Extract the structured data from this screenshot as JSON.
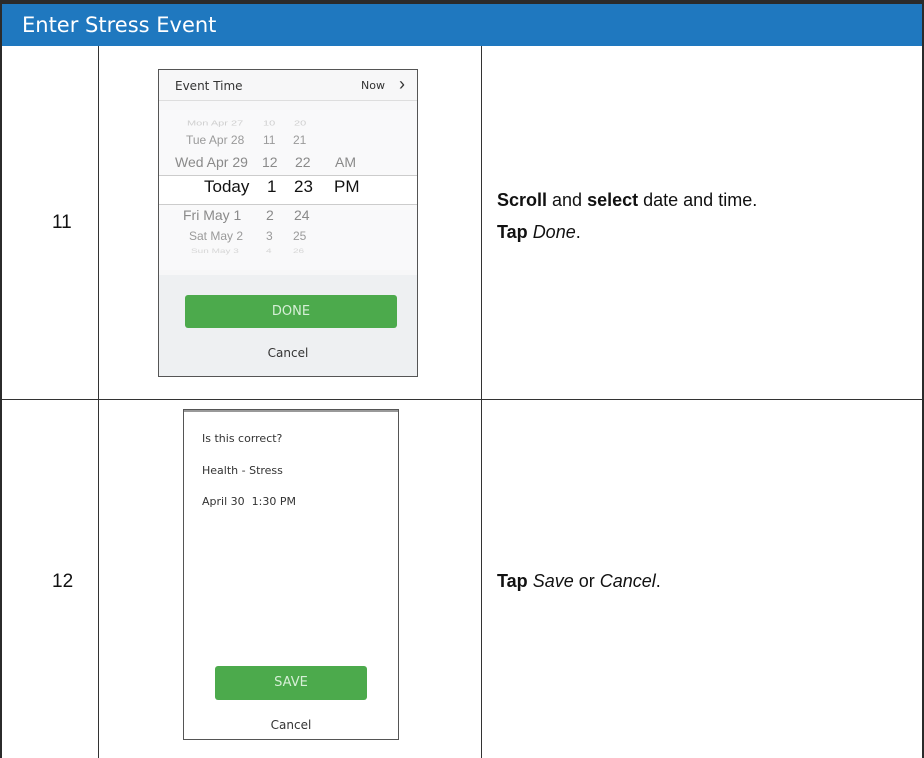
{
  "header": {
    "title": "Enter Stress Event"
  },
  "rows": [
    {
      "number": "11",
      "instruction": {
        "line1_bold1": "Scroll",
        "line1_text1": " and ",
        "line1_bold2": "select",
        "line1_text2": " date and time.",
        "line2_bold": "Tap",
        "line2_italic": "Done",
        "line2_end": "."
      },
      "screenshot": {
        "title": "Event Time",
        "now_label": "Now",
        "picker": {
          "rows": [
            [
              "Mon Apr 27",
              "10",
              "20",
              ""
            ],
            [
              "Tue Apr 28",
              "11",
              "21",
              ""
            ],
            [
              "Wed Apr 29",
              "12",
              "22",
              "AM"
            ],
            [
              "Today",
              "1",
              "23",
              "PM"
            ],
            [
              "Fri May 1",
              "2",
              "24",
              ""
            ],
            [
              "Sat May 2",
              "3",
              "25",
              ""
            ],
            [
              "Sun May 3",
              "4",
              "26",
              ""
            ]
          ]
        },
        "done_label": "DONE",
        "cancel_label": "Cancel"
      }
    },
    {
      "number": "12",
      "instruction": {
        "bold": "Tap",
        "italic1": "Save",
        "text_or": " or ",
        "italic2": "Cancel",
        "end": "."
      },
      "screenshot": {
        "question": "Is this correct?",
        "category": "Health - Stress",
        "datetime": "April 30  1:30 PM",
        "save_label": "SAVE",
        "cancel_label": "Cancel"
      }
    }
  ],
  "colors": {
    "header_bg": "#1f78bf",
    "button_green": "#4caa4c"
  }
}
